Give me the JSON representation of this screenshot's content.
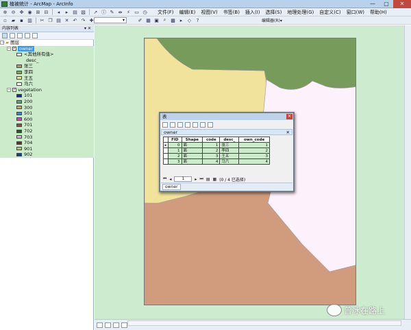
{
  "window": {
    "title": "植被统计 - ArcMap - ArcInfo",
    "min": "—",
    "max": "▢",
    "close": "✕"
  },
  "menu": [
    "文件(F)",
    "编辑(E)",
    "视图(V)",
    "书签(B)",
    "插入(I)",
    "选择(S)",
    "地理处理(G)",
    "自定义(C)",
    "窗口(W)",
    "帮助(H)"
  ],
  "editor_label": "编辑器(R)▾",
  "toc": {
    "title": "内容列表",
    "pin": "▾ ✕",
    "root": "图层",
    "layer1": {
      "name": "owner",
      "items": [
        {
          "label": "<其他所有值>",
          "color": "#ffffff"
        },
        {
          "label": "desc_",
          "color": null
        },
        {
          "label": "张三",
          "color": "#b39a6c"
        },
        {
          "label": "李四",
          "color": "#7fa36a"
        },
        {
          "label": "王五",
          "color": "#f0e6a0"
        },
        {
          "label": "马六",
          "color": "#ffffff"
        }
      ]
    },
    "layer2": {
      "name": "vegetation",
      "items": [
        {
          "label": "101",
          "color": "#1e2f7e"
        },
        {
          "label": "200",
          "color": "#44b36b"
        },
        {
          "label": "300",
          "color": "#d9a441"
        },
        {
          "label": "501",
          "color": "#4a7fc9"
        },
        {
          "label": "600",
          "color": "#c94fb6"
        },
        {
          "label": "701",
          "color": "#a04b2a"
        },
        {
          "label": "702",
          "color": "#1f5e2b"
        },
        {
          "label": "703",
          "color": "#cdb7d4"
        },
        {
          "label": "704",
          "color": "#5a3d16"
        },
        {
          "label": "901",
          "color": "#a7d24f"
        },
        {
          "label": "902",
          "color": "#1c3d8a"
        }
      ]
    }
  },
  "table": {
    "title": "表",
    "layer_tab": "owner",
    "close": "✕",
    "columns": [
      "FID",
      "Shape",
      "code",
      "desc_",
      "own_code"
    ],
    "rows": [
      [
        "0",
        "面",
        "1",
        "张三",
        "1"
      ],
      [
        "1",
        "面",
        "2",
        "李四",
        "2"
      ],
      [
        "2",
        "面",
        "3",
        "王五",
        "3"
      ],
      [
        "3",
        "面",
        "4",
        "马六",
        "4"
      ]
    ],
    "page": "1",
    "selected_status": "(0 / 4 已选择)",
    "footer_tab": "owner"
  },
  "map_colors": {
    "background": "#cdeccf",
    "brown": "#d09c7d",
    "green": "#779b5b",
    "yellow": "#f1e39b",
    "pink": "#fdf1fb"
  },
  "watermark": "曾冰在路上"
}
